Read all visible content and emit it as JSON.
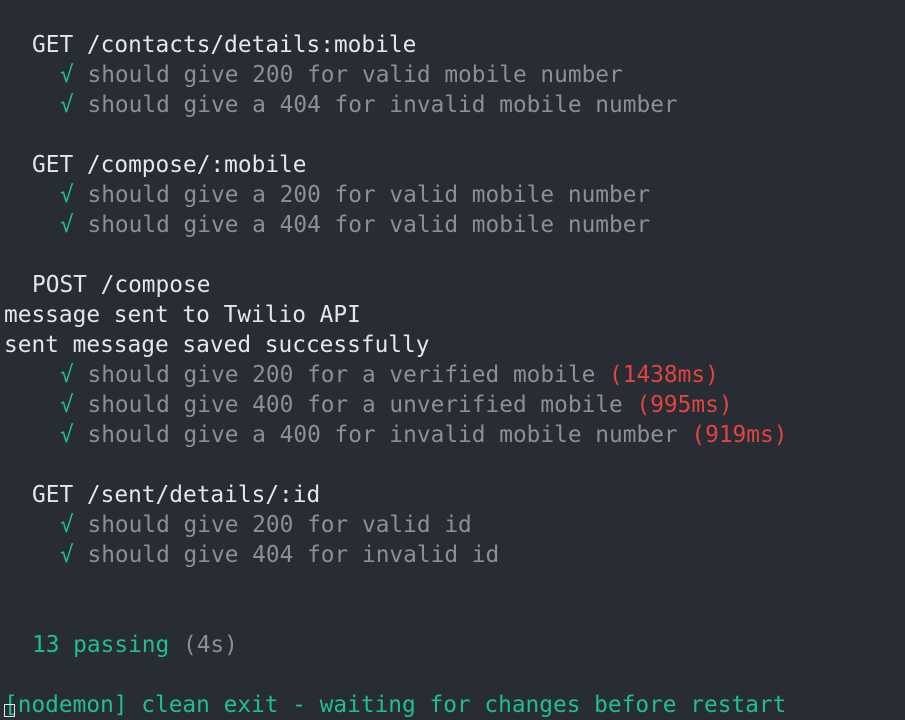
{
  "suites": [
    {
      "title": "GET /contacts/details:mobile",
      "tests": [
        {
          "check": "√",
          "title": "should give 200 for valid mobile number"
        },
        {
          "check": "√",
          "title": "should give a 404 for invalid mobile number"
        }
      ]
    },
    {
      "title": "GET /compose/:mobile",
      "tests": [
        {
          "check": "√",
          "title": "should give a 200 for valid mobile number"
        },
        {
          "check": "√",
          "title": "should give a 404 for valid mobile number"
        }
      ]
    },
    {
      "title": "POST /compose",
      "logs": [
        "message sent to Twilio API",
        "sent message saved successfully"
      ],
      "tests": [
        {
          "check": "√",
          "title": "should give 200 for a verified mobile",
          "duration": "(1438ms)"
        },
        {
          "check": "√",
          "title": "should give 400 for a unverified mobile",
          "duration": "(995ms)"
        },
        {
          "check": "√",
          "title": "should give a 400 for invalid mobile number",
          "duration": "(919ms)"
        }
      ]
    },
    {
      "title": "GET /sent/details/:id",
      "tests": [
        {
          "check": "√",
          "title": "should give 200 for valid id"
        },
        {
          "check": "√",
          "title": "should give 404 for invalid id"
        }
      ]
    }
  ],
  "summary": {
    "passing": "13 passing",
    "time": "(4s)"
  },
  "nodemon": "[nodemon] clean exit - waiting for changes before restart",
  "colors": {
    "background": "#282c34",
    "foreground": "#e3e6ea",
    "pass": "#1fbf8f",
    "muted": "#8b8f96",
    "slow": "#e2443f"
  }
}
